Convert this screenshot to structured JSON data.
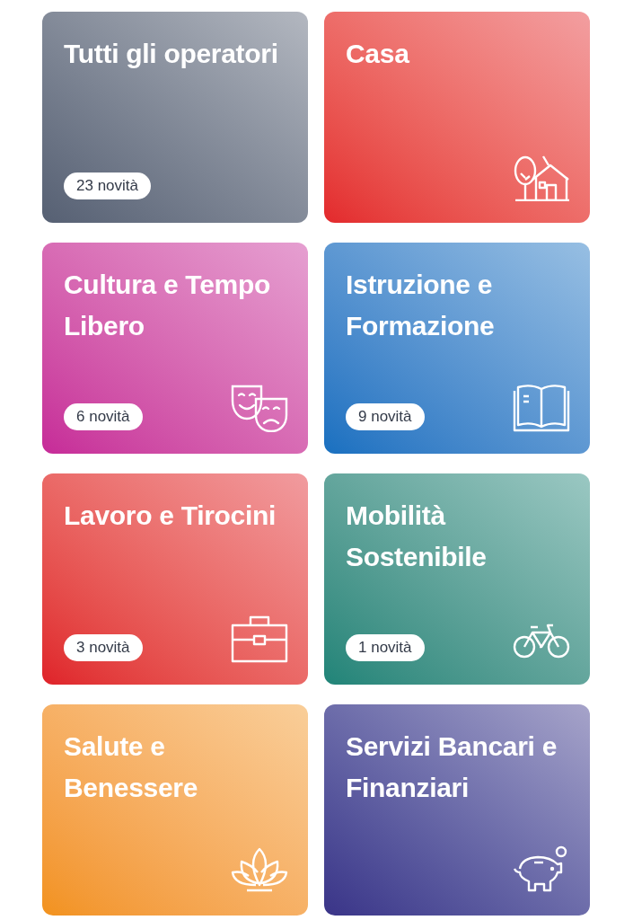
{
  "categories": [
    {
      "title": "Tutti gli operatori",
      "badge": "23 novità",
      "color": "#566073"
    },
    {
      "title": "Casa",
      "color": "#e3282c"
    },
    {
      "title": "Cultura e Tempo Libero",
      "badge": "6 novità",
      "color": "#c62a98"
    },
    {
      "title": "Istruzione e Formazione",
      "badge": "9 novità",
      "color": "#1870c0"
    },
    {
      "title": "Lavoro e Tirocini",
      "badge": "3 novità",
      "color": "#df2129"
    },
    {
      "title": "Mobilità Sostenibile",
      "badge": "1 novità",
      "color": "#1f8478"
    },
    {
      "title": "Salute e Benessere",
      "color": "#f2921c"
    },
    {
      "title": "Servizi Bancari e Finanziari",
      "color": "#3a3488"
    }
  ]
}
